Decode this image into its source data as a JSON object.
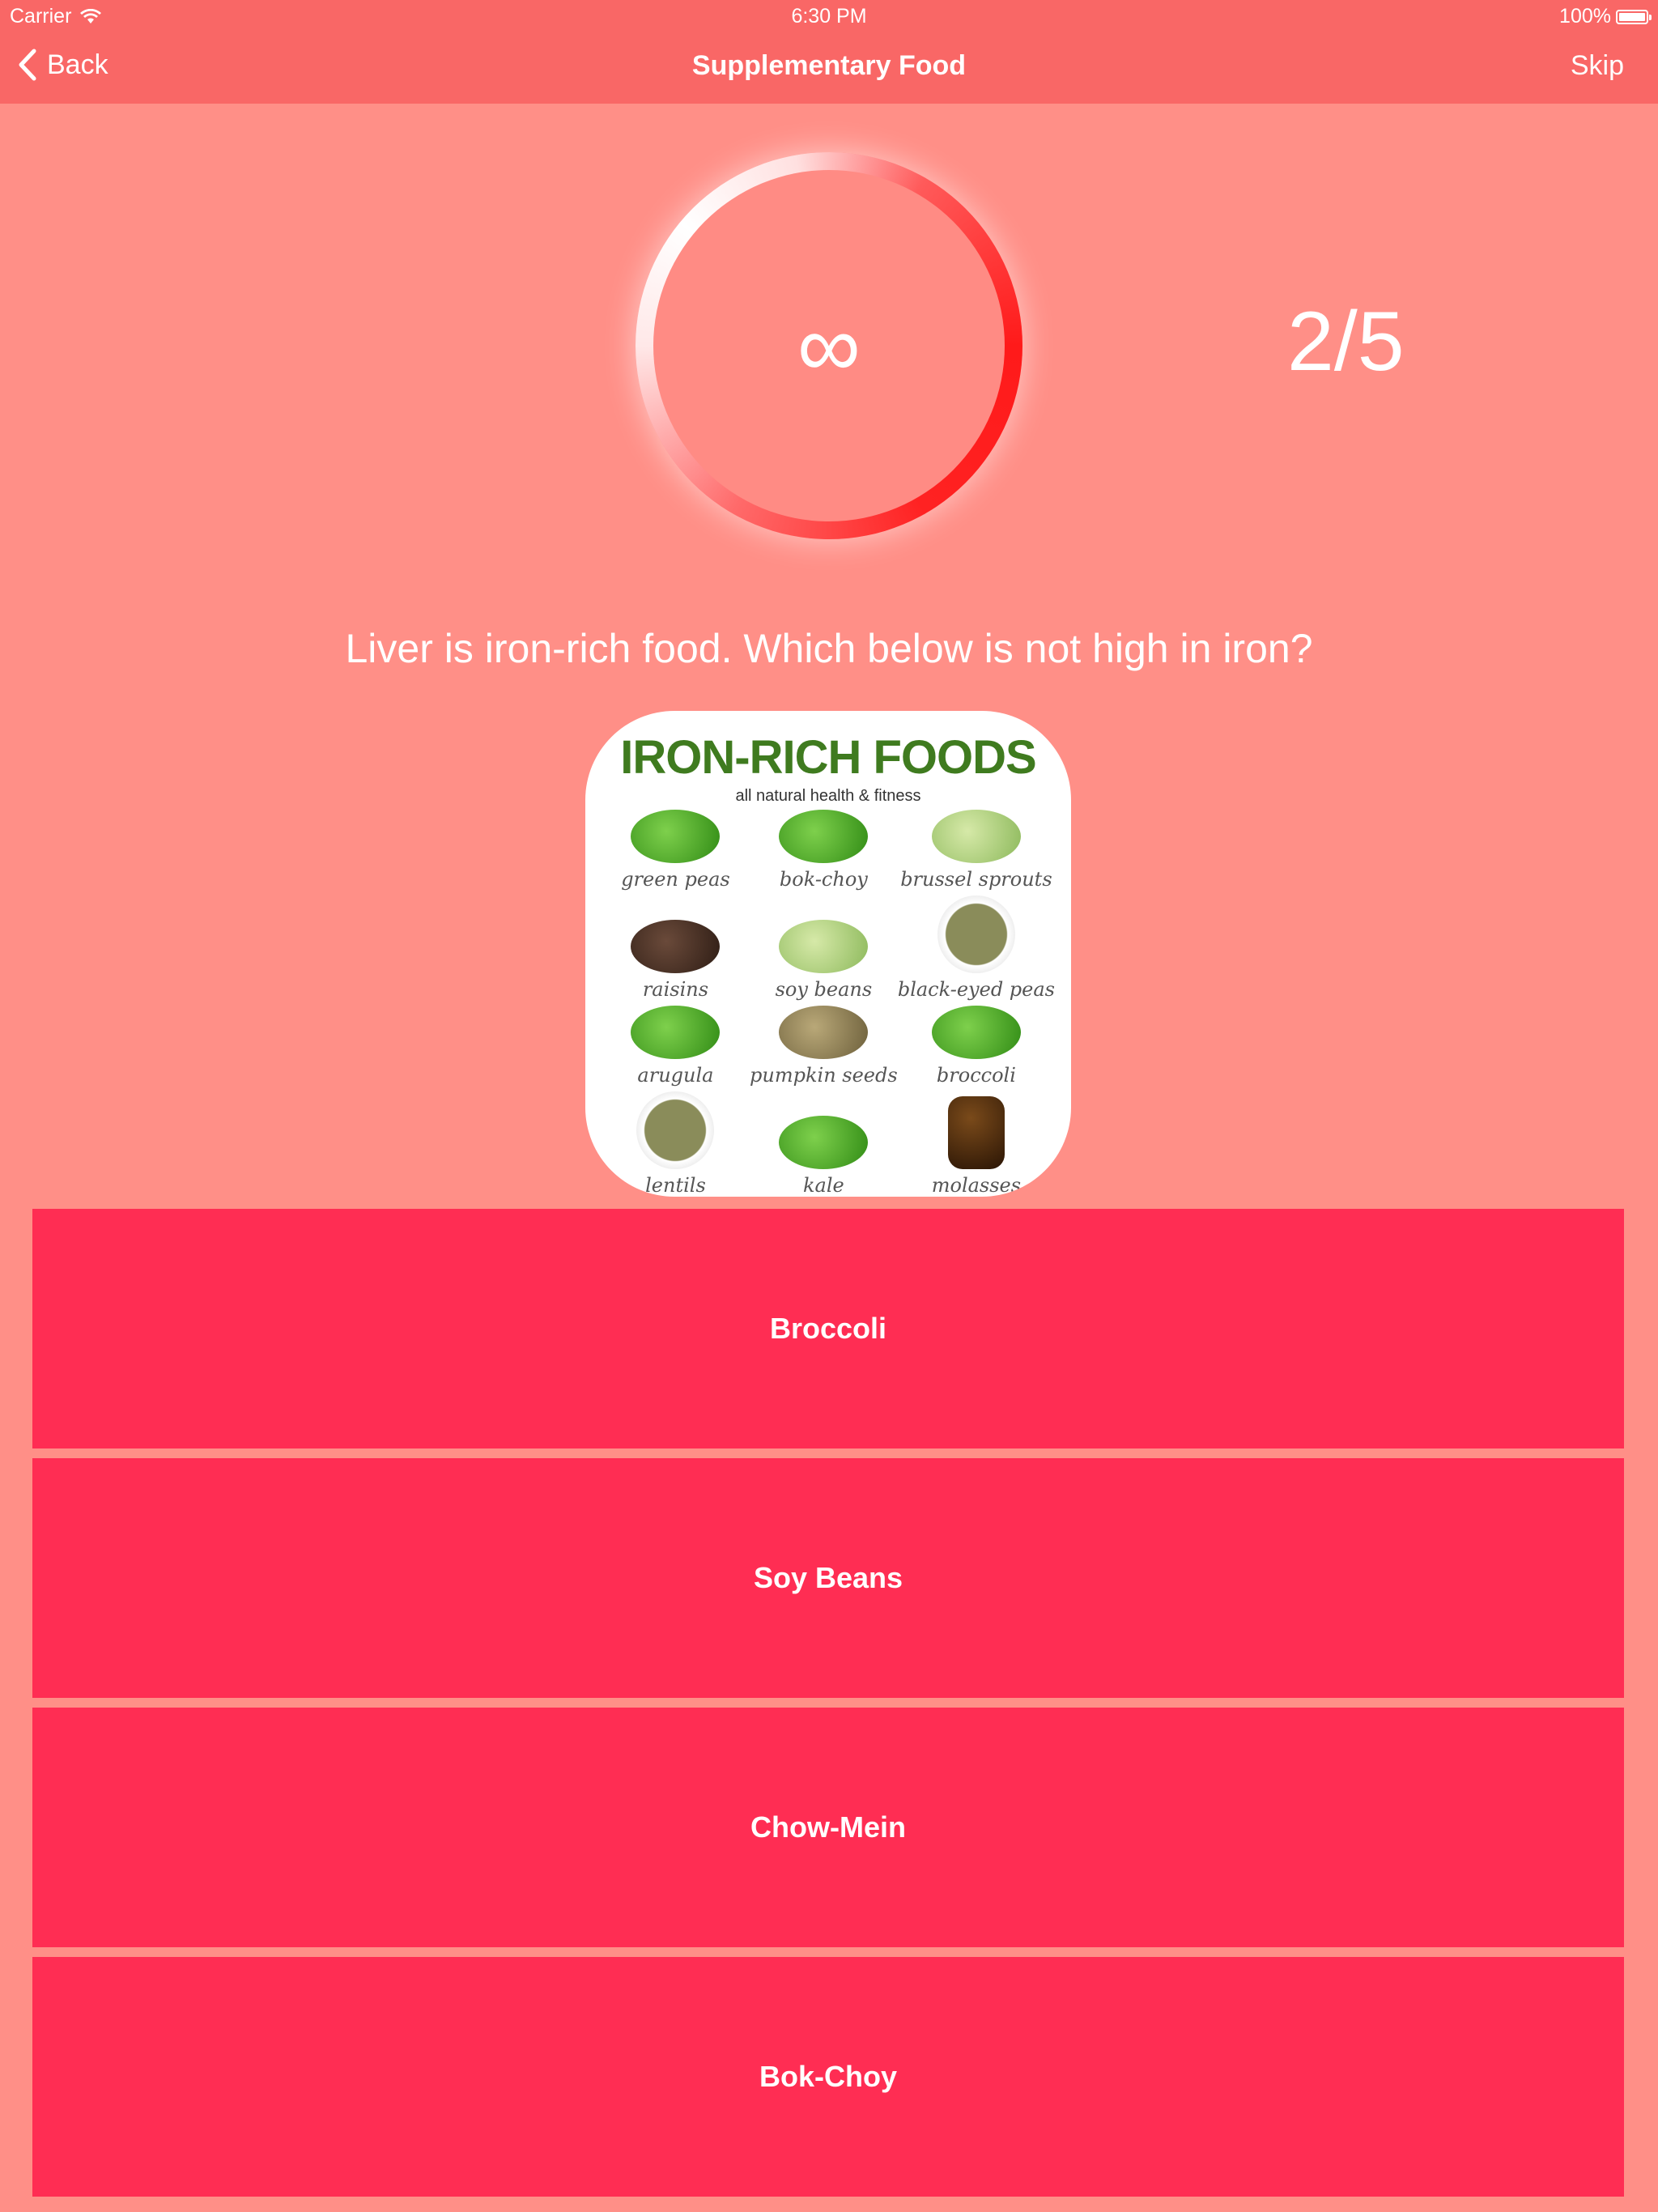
{
  "status_bar": {
    "carrier": "Carrier",
    "time": "6:30 PM",
    "battery": "100%"
  },
  "nav": {
    "back_label": "Back",
    "title": "Supplementary Food",
    "skip_label": "Skip"
  },
  "timer": {
    "symbol": "∞"
  },
  "progress": "2/5",
  "question": "Liver is iron-rich food. Which below is not high in iron?",
  "image": {
    "title": "IRON-RICH FOODS",
    "subtitle": "all natural health & fitness",
    "items": [
      {
        "label": "green peas",
        "icon": "peas-icon"
      },
      {
        "label": "bok-choy",
        "icon": "bok-choy-icon"
      },
      {
        "label": "brussel sprouts",
        "icon": "brussel-sprouts-icon"
      },
      {
        "label": "raisins",
        "icon": "raisins-icon"
      },
      {
        "label": "soy beans",
        "icon": "soy-beans-icon"
      },
      {
        "label": "black-eyed peas",
        "icon": "black-eyed-peas-icon"
      },
      {
        "label": "arugula",
        "icon": "arugula-icon"
      },
      {
        "label": "pumpkin seeds",
        "icon": "pumpkin-seeds-icon"
      },
      {
        "label": "broccoli",
        "icon": "broccoli-icon"
      },
      {
        "label": "lentils",
        "icon": "lentils-icon"
      },
      {
        "label": "kale",
        "icon": "kale-icon"
      },
      {
        "label": "molasses",
        "icon": "molasses-icon"
      }
    ]
  },
  "answers": [
    {
      "label": "Broccoli"
    },
    {
      "label": "Soy Beans"
    },
    {
      "label": "Chow-Mein"
    },
    {
      "label": "Bok-Choy"
    }
  ],
  "colors": {
    "background": "#ff8f87",
    "nav_bar": "#f96766",
    "answer_button": "#ff2d53",
    "timer_ring": "#ff1a1a"
  }
}
